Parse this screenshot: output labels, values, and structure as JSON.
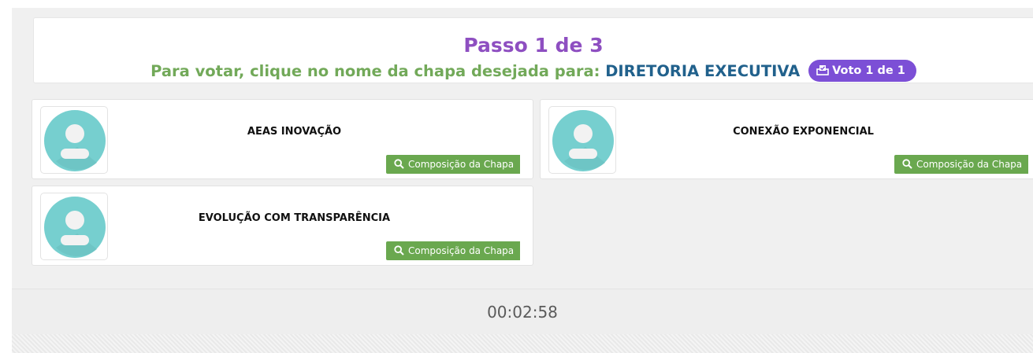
{
  "header": {
    "step_title": "Passo 1 de 3",
    "instruction_lead": "Para votar, clique no nome da chapa desejada para:",
    "office_name": "DIRETORIA EXECUTIVA",
    "vote_badge": "Voto 1 de 1",
    "vote_badge_icon": "ballot-box-icon"
  },
  "chapas": [
    {
      "name": "AEAS INOVAÇÃO",
      "button_label": "Composição da Chapa",
      "avatar_icon": "user-avatar-icon"
    },
    {
      "name": "CONEXÃO EXPONENCIAL",
      "button_label": "Composição da Chapa",
      "avatar_icon": "user-avatar-icon"
    },
    {
      "name": "EVOLUÇÃO COM TRANSPARÊNCIA",
      "button_label": "Composição da Chapa",
      "avatar_icon": "user-avatar-icon"
    }
  ],
  "timer": "00:02:58",
  "colors": {
    "step_title": "#8e4fc1",
    "instruction": "#72a959",
    "office": "#21618c",
    "badge": "#7c4fd6",
    "button": "#6aa84f",
    "avatar": "#76cfcf"
  }
}
